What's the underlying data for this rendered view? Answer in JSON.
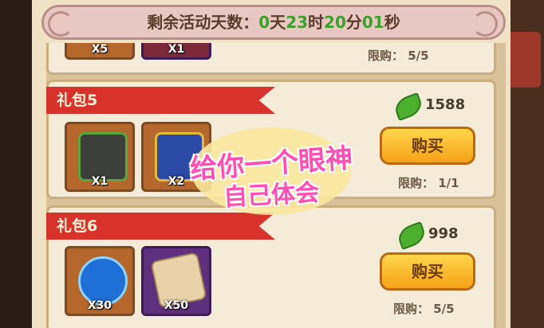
{
  "timer": {
    "prefix": "剩余活动天数：",
    "days": "0",
    "days_unit": "天",
    "hours": "23",
    "hours_unit": "时",
    "minutes": "20",
    "minutes_unit": "分",
    "seconds": "01",
    "seconds_unit": "秒"
  },
  "packs": [
    {
      "title": "",
      "items": [
        {
          "qty": "X5"
        },
        {
          "qty": "X1"
        }
      ],
      "limit": "限购： 5/5"
    },
    {
      "title": "礼包5",
      "items": [
        {
          "qty": "X1"
        },
        {
          "qty": "X2"
        }
      ],
      "price": "1588",
      "buy_label": "购买",
      "limit": "限购： 1/1"
    },
    {
      "title": "礼包6",
      "items": [
        {
          "qty": "X30"
        },
        {
          "qty": "X50"
        }
      ],
      "price": "998",
      "buy_label": "购买",
      "limit": "限购： 5/5"
    }
  ],
  "overlay": {
    "line1": "给你一个眼神",
    "line2": "自己体会"
  },
  "icons": {
    "currency": "green-leaf-gem-icon"
  }
}
